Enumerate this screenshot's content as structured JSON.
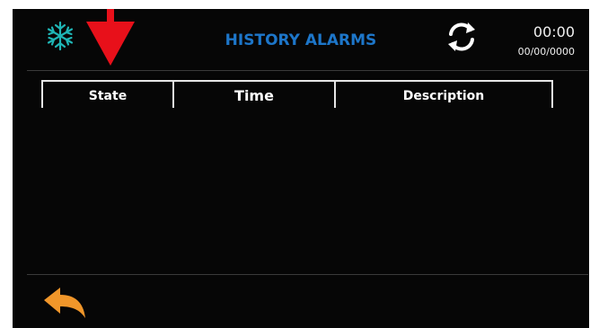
{
  "header": {
    "title": "HISTORY ALARMS",
    "time": "00:00",
    "date": "00/00/0000"
  },
  "table": {
    "columns": [
      "State",
      "Time",
      "Description"
    ],
    "rows": []
  },
  "icons": {
    "mode": "snowflake-icon",
    "alarm_marker": "down-arrow-icon",
    "refresh": "sync-icon",
    "back": "back-arrow-icon"
  },
  "colors": {
    "accent": "#1d76c9",
    "snowflake": "#1fb5b5",
    "alarm": "#e8101a",
    "back": "#f0962a",
    "background": "#060606"
  }
}
